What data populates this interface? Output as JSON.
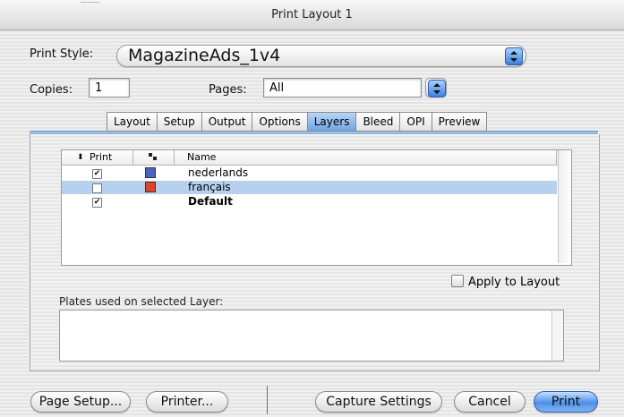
{
  "window": {
    "title": "Print Layout 1"
  },
  "print_style": {
    "label": "Print Style:",
    "value": "MagazineAds_1v4",
    "icon": "popup-stepper-icon"
  },
  "copies": {
    "label": "Copies:",
    "value": "1"
  },
  "pages": {
    "label": "Pages:",
    "value": "All",
    "icon": "popup-stepper-icon"
  },
  "tabs": [
    {
      "label": "Layout",
      "active": false
    },
    {
      "label": "Setup",
      "active": false
    },
    {
      "label": "Output",
      "active": false
    },
    {
      "label": "Options",
      "active": false
    },
    {
      "label": "Layers",
      "active": true
    },
    {
      "label": "Bleed",
      "active": false
    },
    {
      "label": "OPI",
      "active": false
    },
    {
      "label": "Preview",
      "active": false
    }
  ],
  "layers_table": {
    "columns": {
      "print": "Print",
      "color_icon": "color-key-icon",
      "name": "Name",
      "sort_icon": "sort-arrows-icon"
    },
    "rows": [
      {
        "print": true,
        "color": "#4a63c4",
        "name": "nederlands",
        "selected": false,
        "bold": false
      },
      {
        "print": false,
        "color": "#e0442d",
        "name": "français",
        "selected": true,
        "bold": false
      },
      {
        "print": true,
        "color": "",
        "name": "Default",
        "selected": false,
        "bold": true
      }
    ]
  },
  "apply_to_layout": {
    "label": "Apply to Layout",
    "checked": false
  },
  "plates": {
    "label": "Plates used on selected Layer:"
  },
  "buttons": {
    "page_setup": "Page Setup...",
    "printer": "Printer...",
    "capture_settings": "Capture Settings",
    "cancel": "Cancel",
    "print": "Print"
  },
  "colors": {
    "accent": "#4f8fe6",
    "selection": "#b6d0ee"
  }
}
